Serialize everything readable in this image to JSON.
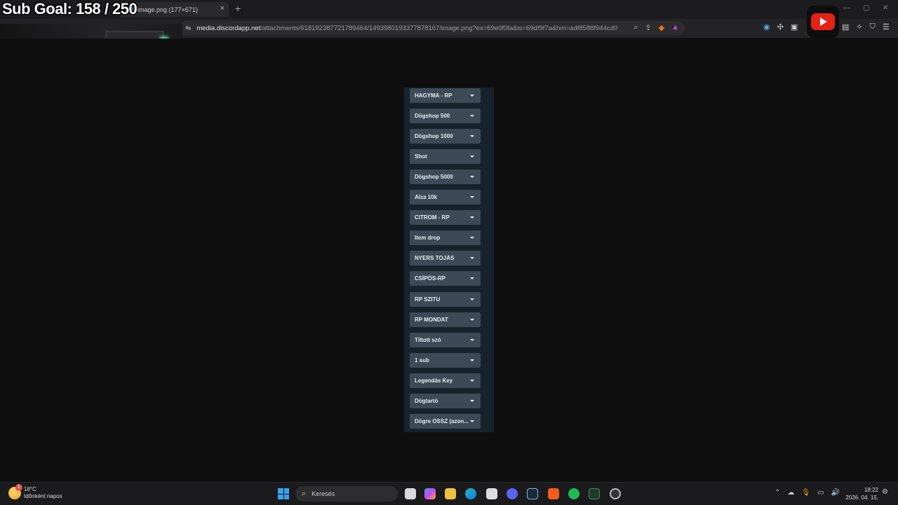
{
  "overlay": {
    "sub_goal": "Sub Goal:  158  /  250"
  },
  "browser": {
    "inactive_tab_label": "lin",
    "active_tab": {
      "title": "image.png (177×671)",
      "close_icon": "×"
    },
    "new_tab_label": "+",
    "url": {
      "host": "media.discordapp.net",
      "path": "/attachments/618192387721789464/1493980193377878167/image.png?ex=69e0f0fa&is=69df9f7a&hm=adf8588f944cd0..."
    }
  },
  "dropdowns": [
    "HAGYMA - RP",
    "Dögshop 500",
    "Dögshop 1000",
    "Shot",
    "Dögshop 5000",
    "Alza 10k",
    "CITROM - RP",
    "Item drop",
    "NYERS TOJÁS",
    "CSÍPŐS-RP",
    "RP SZITU",
    "RP MONDAT",
    "Tiltott szó",
    "1 sub",
    "Legendás Key",
    "Dögtartó",
    "Dögre OSSZ (azon..."
  ],
  "taskbar": {
    "weather": {
      "temp": "18°C",
      "desc": "Időnként napos",
      "badge": "1"
    },
    "search_label": "Keresés",
    "time": "18:22",
    "date": "2026. 04. 15."
  },
  "colors": {
    "panel_bg": "#16232d",
    "dropdown_bg": "#3b4a56",
    "page_bg": "#0f0f10"
  }
}
